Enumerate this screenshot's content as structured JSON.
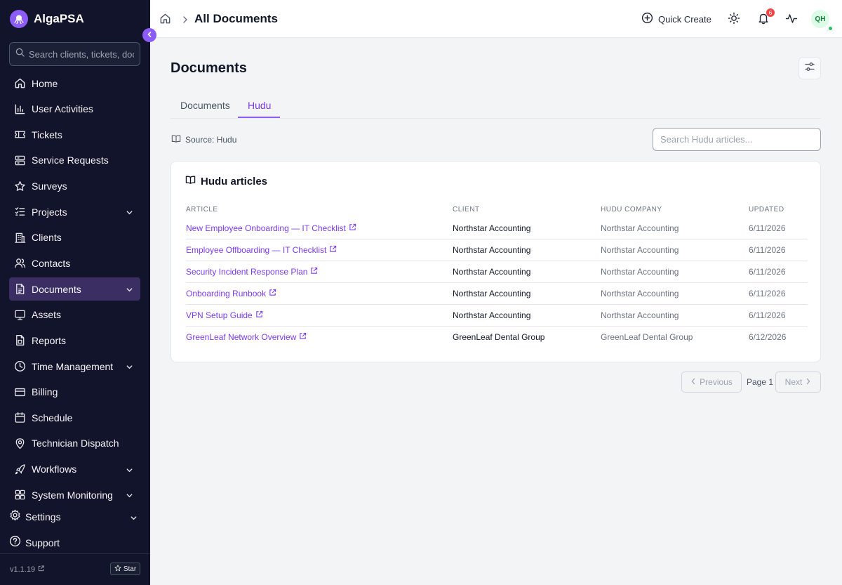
{
  "app": {
    "name": "AlgaPSA"
  },
  "sidebar": {
    "search_placeholder": "Search clients, tickets, documents",
    "items": [
      {
        "label": "Home",
        "icon": "home-icon",
        "expandable": false,
        "active": false
      },
      {
        "label": "User Activities",
        "icon": "bar-chart-icon",
        "expandable": false,
        "active": false
      },
      {
        "label": "Tickets",
        "icon": "ticket-icon",
        "expandable": false,
        "active": false
      },
      {
        "label": "Service Requests",
        "icon": "service-requests-icon",
        "expandable": false,
        "active": false
      },
      {
        "label": "Surveys",
        "icon": "star-icon",
        "expandable": false,
        "active": false
      },
      {
        "label": "Projects",
        "icon": "list-checks-icon",
        "expandable": true,
        "active": false
      },
      {
        "label": "Clients",
        "icon": "building-icon",
        "expandable": false,
        "active": false
      },
      {
        "label": "Contacts",
        "icon": "users-icon",
        "expandable": false,
        "active": false
      },
      {
        "label": "Documents",
        "icon": "document-icon",
        "expandable": true,
        "active": true
      },
      {
        "label": "Assets",
        "icon": "monitor-icon",
        "expandable": false,
        "active": false
      },
      {
        "label": "Reports",
        "icon": "report-icon",
        "expandable": false,
        "active": false
      },
      {
        "label": "Time Management",
        "icon": "clock-icon",
        "expandable": true,
        "active": false
      },
      {
        "label": "Billing",
        "icon": "credit-card-icon",
        "expandable": false,
        "active": false
      },
      {
        "label": "Schedule",
        "icon": "calendar-icon",
        "expandable": false,
        "active": false
      },
      {
        "label": "Technician Dispatch",
        "icon": "map-pin-icon",
        "expandable": false,
        "active": false
      },
      {
        "label": "Workflows",
        "icon": "rocket-icon",
        "expandable": true,
        "active": false
      },
      {
        "label": "System Monitoring",
        "icon": "grid-icon",
        "expandable": true,
        "active": false
      }
    ],
    "settings_label": "Settings",
    "support_label": "Support",
    "version": "v1.1.19",
    "star_label": "Star"
  },
  "header": {
    "breadcrumb_title": "All Documents",
    "quick_create_label": "Quick Create",
    "notification_count": "6",
    "avatar_initials": "QH"
  },
  "main": {
    "title": "Documents",
    "tabs": [
      {
        "label": "Documents",
        "active": false
      },
      {
        "label": "Hudu",
        "active": true
      }
    ],
    "source_label": "Source: Hudu",
    "search_placeholder": "Search Hudu articles...",
    "card_title": "Hudu articles",
    "columns": [
      "ARTICLE",
      "CLIENT",
      "HUDU COMPANY",
      "UPDATED"
    ],
    "rows": [
      {
        "article": "New Employee Onboarding — IT Checklist",
        "client": "Northstar Accounting",
        "company": "Northstar Accounting",
        "updated": "6/11/2026"
      },
      {
        "article": "Employee Offboarding — IT Checklist",
        "client": "Northstar Accounting",
        "company": "Northstar Accounting",
        "updated": "6/11/2026"
      },
      {
        "article": "Security Incident Response Plan",
        "client": "Northstar Accounting",
        "company": "Northstar Accounting",
        "updated": "6/11/2026"
      },
      {
        "article": "Onboarding Runbook",
        "client": "Northstar Accounting",
        "company": "Northstar Accounting",
        "updated": "6/11/2026"
      },
      {
        "article": "VPN Setup Guide",
        "client": "Northstar Accounting",
        "company": "Northstar Accounting",
        "updated": "6/11/2026"
      },
      {
        "article": "GreenLeaf Network Overview",
        "client": "GreenLeaf Dental Group",
        "company": "GreenLeaf Dental Group",
        "updated": "6/12/2026"
      }
    ],
    "pagination": {
      "previous_label": "Previous",
      "page_label": "Page 1",
      "next_label": "Next"
    }
  },
  "colors": {
    "accent": "#8b5cf6",
    "sidebar_bg": "#11142a",
    "active_nav_bg": "#3a2e63",
    "link": "#7c3aed",
    "badge": "#ef4444",
    "online": "#22c55e"
  }
}
